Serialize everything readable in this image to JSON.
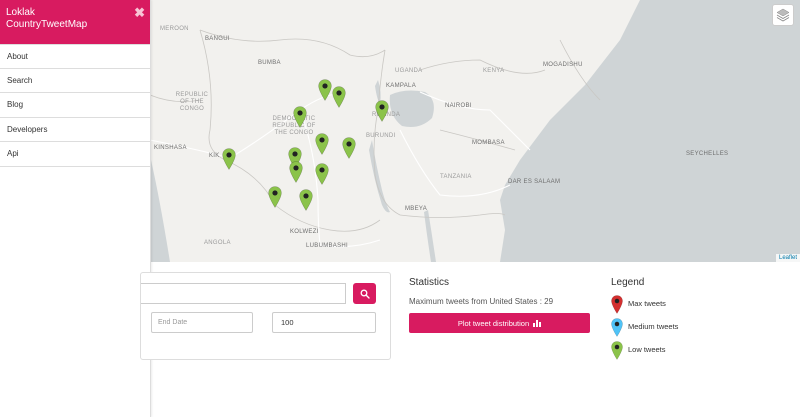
{
  "sidebar": {
    "title": "Loklak CountryTweetMap",
    "close_glyph": "✖",
    "items": [
      {
        "label": "About"
      },
      {
        "label": "Search"
      },
      {
        "label": "Blog"
      },
      {
        "label": "Developers"
      },
      {
        "label": "Api"
      }
    ]
  },
  "map": {
    "attribution": "Leaflet",
    "labels": {
      "cameroon": "MEROON",
      "bangui": "BANGUI",
      "bumba": "BUMBA",
      "uganda": "UGANDA",
      "kenya": "KENYA",
      "kampala": "KAMPALA",
      "mogadishu": "MOGADISHU",
      "rep_congo": "REPUBLIC OF THE CONGO",
      "drc": "DEMOCRATIC REPUBLIC OF THE CONGO",
      "rwanda": "RWANDA",
      "nairobi": "NAIROBI",
      "burundi": "BURUNDI",
      "kinshasa": "KINSHASA",
      "kikwit": "KIK",
      "mombasa": "MOMBASA",
      "tanzania": "TANZANIA",
      "dar": "DAR ES SALAAM",
      "mbeya": "MBEYA",
      "kolwezi": "KOLWEZI",
      "lubumbashi": "LUBUMBASHI",
      "angola": "ANGOLA",
      "seychelles": "SEYCHELLES"
    },
    "marker_color": "#8bc34a"
  },
  "search": {
    "query": "",
    "end_date_placeholder": "End Date",
    "count_value": "100"
  },
  "statistics": {
    "title": "Statistics",
    "max_text": "Maximum tweets from United States : 29",
    "plot_label": "Plot tweet distribution"
  },
  "legend": {
    "title": "Legend",
    "items": [
      {
        "label": "Max tweets",
        "color": "#d32f2f"
      },
      {
        "label": "Medium tweets",
        "color": "#4fc3f7"
      },
      {
        "label": "Low tweets",
        "color": "#8bc34a"
      }
    ]
  },
  "colors": {
    "accent": "#d81b60",
    "map_land": "#f2f1ee",
    "map_water": "#cfd4d6"
  }
}
